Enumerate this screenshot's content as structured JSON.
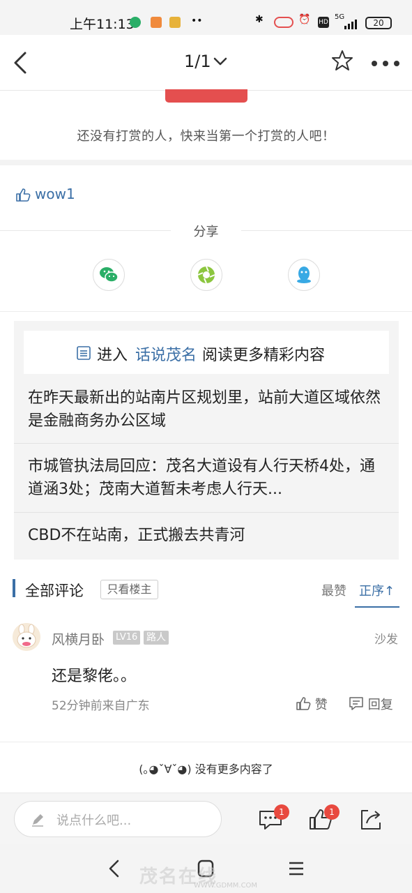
{
  "status_bar": {
    "time": "上午11:13",
    "network": "5G",
    "battery": "20"
  },
  "nav": {
    "page_indicator": "1/1"
  },
  "reward": {
    "empty_text": "还没有打赏的人，快来当第一个打赏的人吧！"
  },
  "like": {
    "user": "wow1"
  },
  "share": {
    "label": "分享",
    "targets": [
      "wechat-icon",
      "moments-icon",
      "qq-icon"
    ]
  },
  "related": {
    "enter_prefix": "进入",
    "forum_name": "话说茂名",
    "enter_suffix": "阅读更多精彩内容",
    "items": [
      "在昨天最新出的站南片区规划里，站前大道区域依然是金融商务办公区域",
      "市城管执法局回应：茂名大道设有人行天桥4处，通道涵3处；茂南大道暂未考虑人行天...",
      "CBD不在站南，正式搬去共青河"
    ]
  },
  "comments": {
    "title": "全部评论",
    "only_op": "只看楼主",
    "tab_hot": "最赞",
    "tab_order": "正序↑",
    "list": [
      {
        "user": "风横月卧",
        "level": "LV16",
        "role": "路人",
        "floor": "沙发",
        "text": "还是黎佬。。",
        "meta": "52分钟前来自广东",
        "like_label": "赞",
        "reply_label": "回复"
      }
    ],
    "no_more": "(｡◕ˇ∀ˇ◕) 没有更多内容了"
  },
  "bottom_bar": {
    "input_placeholder": "说点什么吧...",
    "comment_badge": "1",
    "like_badge": "1"
  },
  "watermark": {
    "brand": "茂名在线",
    "url": "WWW.GDMM.COM"
  },
  "colors": {
    "accent": "#3b6fa6",
    "reward_red": "#e44f4f",
    "badge_red": "#e8493f",
    "wechat_green": "#2aae67",
    "qq_blue": "#38a9e4"
  }
}
